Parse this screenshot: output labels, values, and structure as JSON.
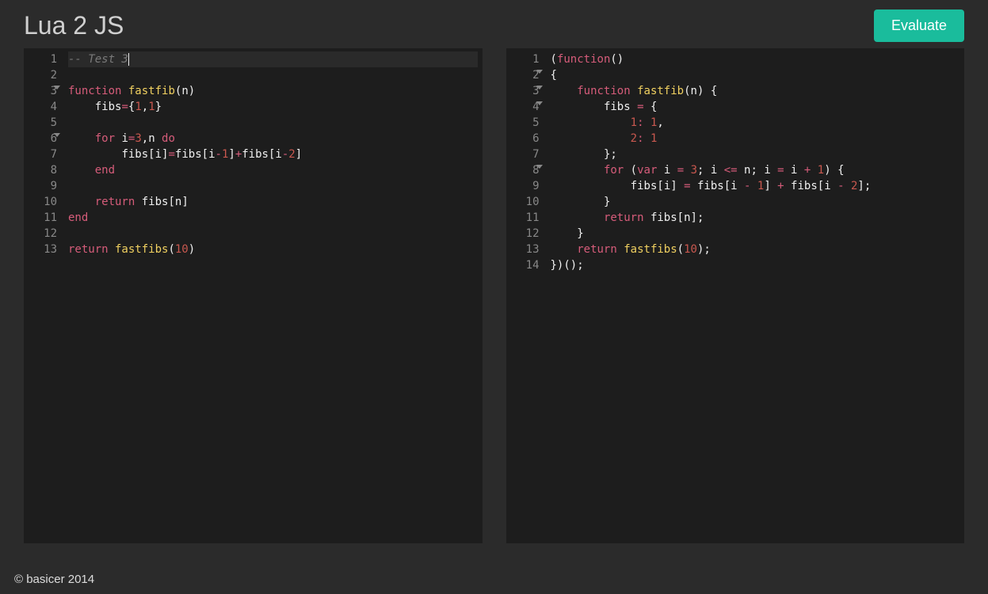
{
  "header": {
    "title": "Lua 2 JS",
    "evaluate_label": "Evaluate"
  },
  "footer": "© basicer 2014",
  "left_editor": {
    "language": "lua",
    "active_line": 1,
    "lines": [
      {
        "n": 1,
        "fold": false,
        "tokens": [
          [
            "comment",
            "-- Test 3"
          ]
        ],
        "cursor_after": true
      },
      {
        "n": 2,
        "fold": false,
        "tokens": []
      },
      {
        "n": 3,
        "fold": true,
        "tokens": [
          [
            "keyword",
            "function"
          ],
          [
            "",
            ""
          ],
          [
            "func",
            " fastfib"
          ],
          [
            "paren",
            "("
          ],
          [
            "ident",
            "n"
          ],
          [
            "paren",
            ")"
          ]
        ]
      },
      {
        "n": 4,
        "fold": false,
        "tokens": [
          [
            "",
            "    "
          ],
          [
            "ident",
            "fibs"
          ],
          [
            "op",
            "="
          ],
          [
            "paren",
            "{"
          ],
          [
            "number",
            "1"
          ],
          [
            "",
            ","
          ],
          [
            "number",
            "1"
          ],
          [
            "paren",
            "}"
          ]
        ]
      },
      {
        "n": 5,
        "fold": false,
        "tokens": []
      },
      {
        "n": 6,
        "fold": true,
        "tokens": [
          [
            "",
            "    "
          ],
          [
            "keyword",
            "for"
          ],
          [
            "ident",
            " i"
          ],
          [
            "op",
            "="
          ],
          [
            "number",
            "3"
          ],
          [
            "",
            ","
          ],
          [
            "ident",
            "n "
          ],
          [
            "keyword",
            "do"
          ]
        ]
      },
      {
        "n": 7,
        "fold": false,
        "tokens": [
          [
            "",
            "        "
          ],
          [
            "ident",
            "fibs"
          ],
          [
            "paren",
            "["
          ],
          [
            "ident",
            "i"
          ],
          [
            "paren",
            "]"
          ],
          [
            "op",
            "="
          ],
          [
            "ident",
            "fibs"
          ],
          [
            "paren",
            "["
          ],
          [
            "ident",
            "i"
          ],
          [
            "op",
            "-"
          ],
          [
            "number",
            "1"
          ],
          [
            "paren",
            "]"
          ],
          [
            "op",
            "+"
          ],
          [
            "ident",
            "fibs"
          ],
          [
            "paren",
            "["
          ],
          [
            "ident",
            "i"
          ],
          [
            "op",
            "-"
          ],
          [
            "number",
            "2"
          ],
          [
            "paren",
            "]"
          ]
        ]
      },
      {
        "n": 8,
        "fold": false,
        "tokens": [
          [
            "",
            "    "
          ],
          [
            "keyword",
            "end"
          ]
        ]
      },
      {
        "n": 9,
        "fold": false,
        "tokens": []
      },
      {
        "n": 10,
        "fold": false,
        "tokens": [
          [
            "",
            "    "
          ],
          [
            "keyword",
            "return"
          ],
          [
            "ident",
            " fibs"
          ],
          [
            "paren",
            "["
          ],
          [
            "ident",
            "n"
          ],
          [
            "paren",
            "]"
          ]
        ]
      },
      {
        "n": 11,
        "fold": false,
        "tokens": [
          [
            "keyword",
            "end"
          ]
        ]
      },
      {
        "n": 12,
        "fold": false,
        "tokens": []
      },
      {
        "n": 13,
        "fold": false,
        "tokens": [
          [
            "keyword",
            "return"
          ],
          [
            "func",
            " fastfibs"
          ],
          [
            "paren",
            "("
          ],
          [
            "number",
            "10"
          ],
          [
            "paren",
            ")"
          ]
        ]
      }
    ]
  },
  "right_editor": {
    "language": "javascript",
    "active_line": 0,
    "lines": [
      {
        "n": 1,
        "fold": false,
        "tokens": [
          [
            "paren",
            "("
          ],
          [
            "keyword",
            "function"
          ],
          [
            "paren",
            "()"
          ]
        ]
      },
      {
        "n": 2,
        "fold": true,
        "tokens": [
          [
            "paren",
            "{"
          ]
        ]
      },
      {
        "n": 3,
        "fold": true,
        "tokens": [
          [
            "",
            "    "
          ],
          [
            "keyword",
            "function"
          ],
          [
            "func",
            " fastfib"
          ],
          [
            "paren",
            "("
          ],
          [
            "ident",
            "n"
          ],
          [
            "paren",
            ")"
          ],
          [
            "",
            " "
          ],
          [
            "paren",
            "{"
          ]
        ]
      },
      {
        "n": 4,
        "fold": true,
        "tokens": [
          [
            "",
            "        "
          ],
          [
            "ident",
            "fibs"
          ],
          [
            "op",
            " = "
          ],
          [
            "paren",
            "{"
          ]
        ]
      },
      {
        "n": 5,
        "fold": false,
        "tokens": [
          [
            "",
            "            "
          ],
          [
            "number",
            "1"
          ],
          [
            "op",
            ": "
          ],
          [
            "number",
            "1"
          ],
          [
            "",
            ","
          ]
        ]
      },
      {
        "n": 6,
        "fold": false,
        "tokens": [
          [
            "",
            "            "
          ],
          [
            "number",
            "2"
          ],
          [
            "op",
            ": "
          ],
          [
            "number",
            "1"
          ]
        ]
      },
      {
        "n": 7,
        "fold": false,
        "tokens": [
          [
            "",
            "        "
          ],
          [
            "paren",
            "}"
          ],
          [
            "",
            ";"
          ]
        ]
      },
      {
        "n": 8,
        "fold": true,
        "tokens": [
          [
            "",
            "        "
          ],
          [
            "keyword",
            "for"
          ],
          [
            "",
            " "
          ],
          [
            "paren",
            "("
          ],
          [
            "keyword",
            "var"
          ],
          [
            "ident",
            " i"
          ],
          [
            "op",
            " = "
          ],
          [
            "number",
            "3"
          ],
          [
            "",
            "; "
          ],
          [
            "ident",
            "i"
          ],
          [
            "op",
            " <= "
          ],
          [
            "ident",
            "n"
          ],
          [
            "",
            "; "
          ],
          [
            "ident",
            "i"
          ],
          [
            "op",
            " = "
          ],
          [
            "ident",
            "i"
          ],
          [
            "op",
            " + "
          ],
          [
            "number",
            "1"
          ],
          [
            "paren",
            ")"
          ],
          [
            "",
            " "
          ],
          [
            "paren",
            "{"
          ]
        ]
      },
      {
        "n": 9,
        "fold": false,
        "tokens": [
          [
            "",
            "            "
          ],
          [
            "ident",
            "fibs"
          ],
          [
            "paren",
            "["
          ],
          [
            "ident",
            "i"
          ],
          [
            "paren",
            "]"
          ],
          [
            "op",
            " = "
          ],
          [
            "ident",
            "fibs"
          ],
          [
            "paren",
            "["
          ],
          [
            "ident",
            "i"
          ],
          [
            "op",
            " - "
          ],
          [
            "number",
            "1"
          ],
          [
            "paren",
            "]"
          ],
          [
            "op",
            " + "
          ],
          [
            "ident",
            "fibs"
          ],
          [
            "paren",
            "["
          ],
          [
            "ident",
            "i"
          ],
          [
            "op",
            " - "
          ],
          [
            "number",
            "2"
          ],
          [
            "paren",
            "]"
          ],
          [
            "",
            ";"
          ]
        ]
      },
      {
        "n": 10,
        "fold": false,
        "tokens": [
          [
            "",
            "        "
          ],
          [
            "paren",
            "}"
          ]
        ]
      },
      {
        "n": 11,
        "fold": false,
        "tokens": [
          [
            "",
            "        "
          ],
          [
            "keyword",
            "return"
          ],
          [
            "ident",
            " fibs"
          ],
          [
            "paren",
            "["
          ],
          [
            "ident",
            "n"
          ],
          [
            "paren",
            "]"
          ],
          [
            "",
            ";"
          ]
        ]
      },
      {
        "n": 12,
        "fold": false,
        "tokens": [
          [
            "",
            "    "
          ],
          [
            "paren",
            "}"
          ]
        ]
      },
      {
        "n": 13,
        "fold": false,
        "tokens": [
          [
            "",
            "    "
          ],
          [
            "keyword",
            "return"
          ],
          [
            "func",
            " fastfibs"
          ],
          [
            "paren",
            "("
          ],
          [
            "number",
            "10"
          ],
          [
            "paren",
            ")"
          ],
          [
            "",
            ";"
          ]
        ]
      },
      {
        "n": 14,
        "fold": false,
        "tokens": [
          [
            "paren",
            "})()"
          ],
          [
            "",
            ";"
          ]
        ]
      }
    ]
  }
}
